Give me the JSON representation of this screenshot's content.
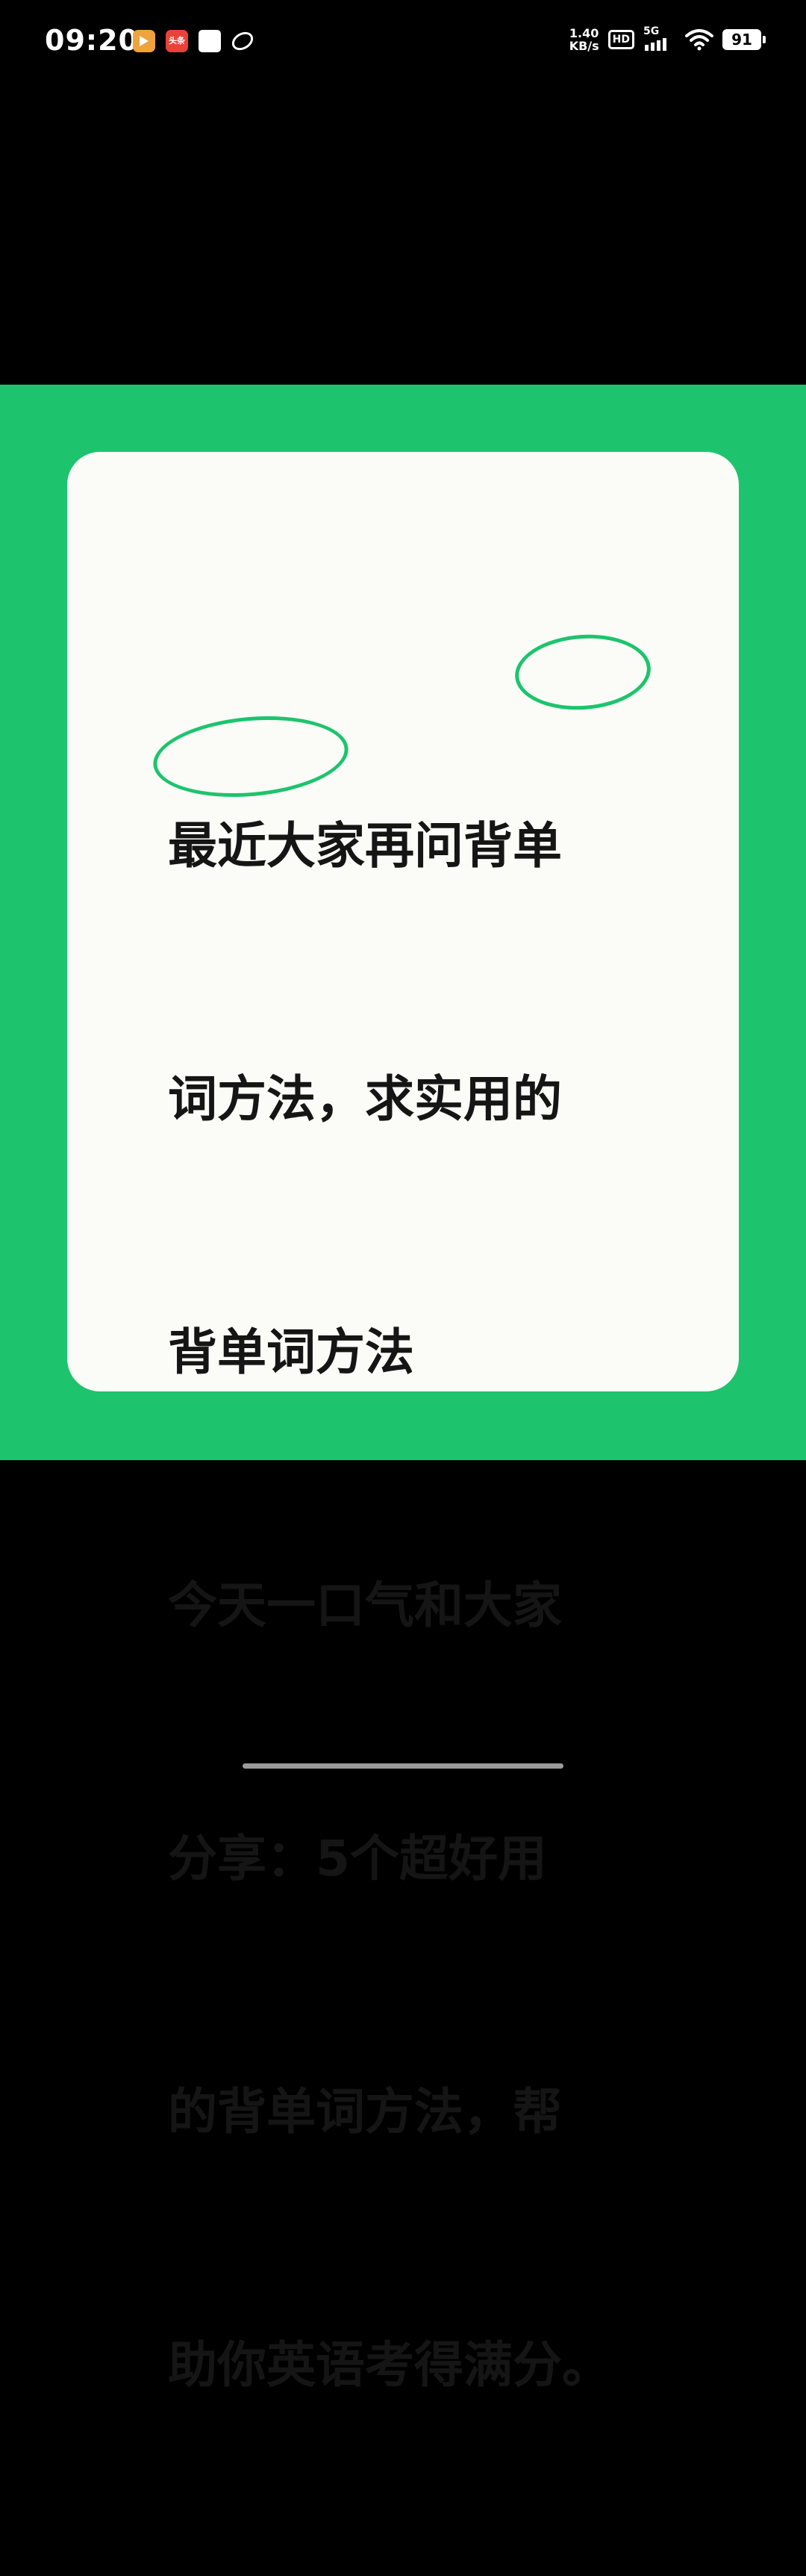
{
  "status_bar": {
    "time": "09:20",
    "notification_icons": [
      "video-app-icon",
      "toutiao-icon",
      "white-square-icon",
      "loop-icon"
    ],
    "toutiao_label": "头条",
    "net_speed_value": "1.40",
    "net_speed_unit": "KB/s",
    "hd_label": "HD",
    "network_type": "5G",
    "battery_level": "91"
  },
  "post_image": {
    "background_color": "#1dc46d",
    "card_color": "#fbfbf8",
    "highlight_color": "#1dc46d",
    "lines": [
      "最近大家再问背单",
      "词方法，求实用的",
      "背单词方法",
      "今天一口气和大家",
      "分享：5个超好用",
      "的背单词方法，帮",
      "助你英语考得满分。"
    ]
  }
}
